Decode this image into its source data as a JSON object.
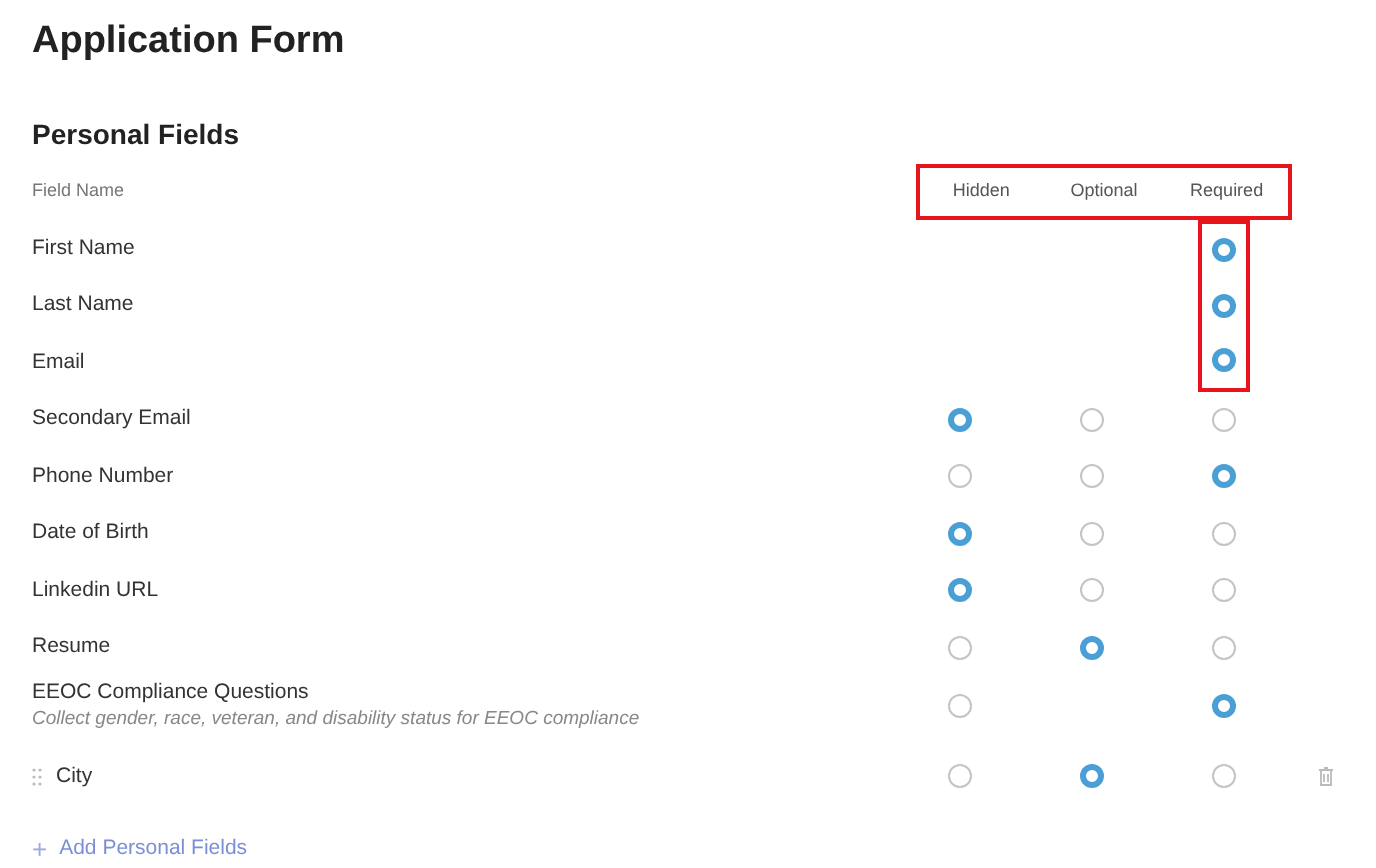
{
  "title": "Application Form",
  "section": {
    "title": "Personal Fields",
    "name_heading": "Field Name",
    "columns": [
      {
        "label": "Hidden"
      },
      {
        "label": "Optional"
      },
      {
        "label": "Required"
      }
    ],
    "columns_highlighted": true
  },
  "rows": [
    {
      "kind": "standard",
      "name": "First Name",
      "options": [
        {
          "kind": "blank"
        },
        {
          "kind": "blank"
        },
        {
          "kind": "radio",
          "selected": true,
          "highlighted": true
        }
      ]
    },
    {
      "kind": "standard",
      "name": "Last Name",
      "options": [
        {
          "kind": "blank"
        },
        {
          "kind": "blank"
        },
        {
          "kind": "radio",
          "selected": true,
          "highlighted": true
        }
      ]
    },
    {
      "kind": "standard",
      "name": "Email",
      "options": [
        {
          "kind": "blank"
        },
        {
          "kind": "blank"
        },
        {
          "kind": "radio",
          "selected": true,
          "highlighted": true
        }
      ]
    },
    {
      "kind": "standard",
      "name": "Secondary Email",
      "options": [
        {
          "kind": "radio",
          "selected": true
        },
        {
          "kind": "radio",
          "selected": false
        },
        {
          "kind": "radio",
          "selected": false
        }
      ]
    },
    {
      "kind": "standard",
      "name": "Phone Number",
      "options": [
        {
          "kind": "radio",
          "selected": false
        },
        {
          "kind": "radio",
          "selected": false
        },
        {
          "kind": "radio",
          "selected": true
        }
      ]
    },
    {
      "kind": "standard",
      "name": "Date of Birth",
      "options": [
        {
          "kind": "radio",
          "selected": true
        },
        {
          "kind": "radio",
          "selected": false
        },
        {
          "kind": "radio",
          "selected": false
        }
      ]
    },
    {
      "kind": "standard",
      "name": "Linkedin URL",
      "options": [
        {
          "kind": "radio",
          "selected": true
        },
        {
          "kind": "radio",
          "selected": false
        },
        {
          "kind": "radio",
          "selected": false
        }
      ]
    },
    {
      "kind": "standard",
      "name": "Resume",
      "options": [
        {
          "kind": "radio",
          "selected": false
        },
        {
          "kind": "radio",
          "selected": true
        },
        {
          "kind": "radio",
          "selected": false
        }
      ]
    },
    {
      "kind": "standard",
      "name": "EEOC Compliance Questions",
      "description": "Collect gender, race, veteran, and disability status for EEOC compliance",
      "options": [
        {
          "kind": "radio",
          "selected": false
        },
        {
          "kind": "blank"
        },
        {
          "kind": "radio",
          "selected": true
        }
      ]
    },
    {
      "kind": "custom",
      "name": "City",
      "options": [
        {
          "kind": "radio",
          "selected": false
        },
        {
          "kind": "radio",
          "selected": true
        },
        {
          "kind": "radio",
          "selected": false
        }
      ]
    }
  ],
  "add_button": {
    "icon": "+",
    "label": "Add Personal Fields"
  }
}
